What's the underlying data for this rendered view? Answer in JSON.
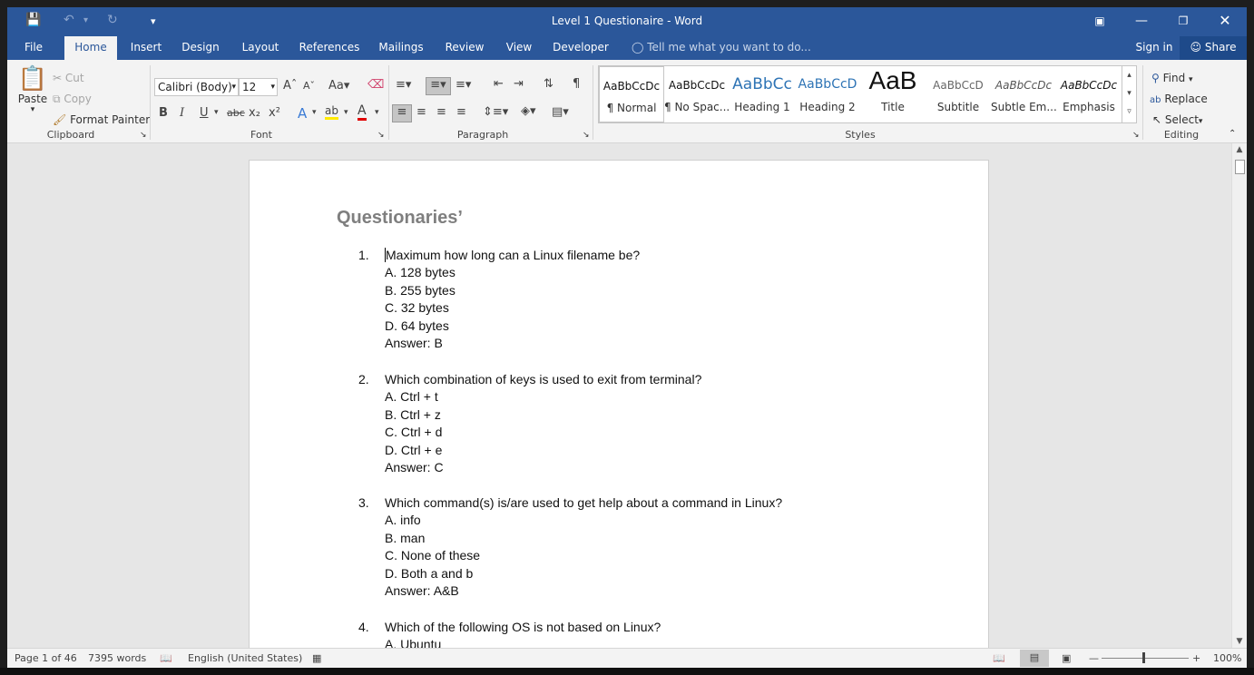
{
  "window": {
    "title": "Level 1 Questionaire - Word"
  },
  "tabs": [
    "File",
    "Home",
    "Insert",
    "Design",
    "Layout",
    "References",
    "Mailings",
    "Review",
    "View",
    "Developer"
  ],
  "tell_me": "Tell me what you want to do...",
  "account": {
    "sign_in": "Sign in",
    "share": "Share"
  },
  "clipboard": {
    "paste": "Paste",
    "cut": "Cut",
    "copy": "Copy",
    "format_painter": "Format Painter",
    "label": "Clipboard"
  },
  "font": {
    "name": "Calibri (Body)",
    "size": "12",
    "label": "Font"
  },
  "paragraph": {
    "label": "Paragraph"
  },
  "styles": {
    "label": "Styles",
    "items": [
      {
        "preview": "AaBbCcDc",
        "name": "¶ Normal"
      },
      {
        "preview": "AaBbCcDc",
        "name": "¶ No Spac..."
      },
      {
        "preview": "AaBbCc",
        "name": "Heading 1"
      },
      {
        "preview": "AaBbCcD",
        "name": "Heading 2"
      },
      {
        "preview": "AaB",
        "name": "Title"
      },
      {
        "preview": "AaBbCcD",
        "name": "Subtitle"
      },
      {
        "preview": "AaBbCcDc",
        "name": "Subtle Em..."
      },
      {
        "preview": "AaBbCcDc",
        "name": "Emphasis"
      }
    ]
  },
  "editing": {
    "find": "Find",
    "replace": "Replace",
    "select": "Select",
    "label": "Editing"
  },
  "document": {
    "title": "Questionaries’",
    "questions": [
      {
        "num": "1.",
        "text": "Maximum how long can a Linux filename be?",
        "options": [
          "A. 128 bytes",
          "B. 255 bytes",
          "C. 32 bytes",
          "D. 64 bytes"
        ],
        "answer": "Answer:  B"
      },
      {
        "num": "2.",
        "text": "Which combination of keys is used to exit from terminal?",
        "options": [
          "A. Ctrl + t",
          "B. Ctrl + z",
          "C. Ctrl + d",
          "D. Ctrl + e"
        ],
        "answer": "Answer:  C"
      },
      {
        "num": "3.",
        "text": "Which command(s) is/are used to get help about a command in Linux?",
        "options": [
          "A. info",
          "B. man",
          "C. None of these",
          "D. Both a and b"
        ],
        "answer": "Answer:  A&B"
      },
      {
        "num": "4.",
        "text": "Which of the following OS is not based on Linux?",
        "options": [
          "A. Ubuntu"
        ],
        "answer": ""
      }
    ]
  },
  "status": {
    "page": "Page 1 of 46",
    "words": "7395 words",
    "language": "English (United States)",
    "zoom": "100%"
  }
}
